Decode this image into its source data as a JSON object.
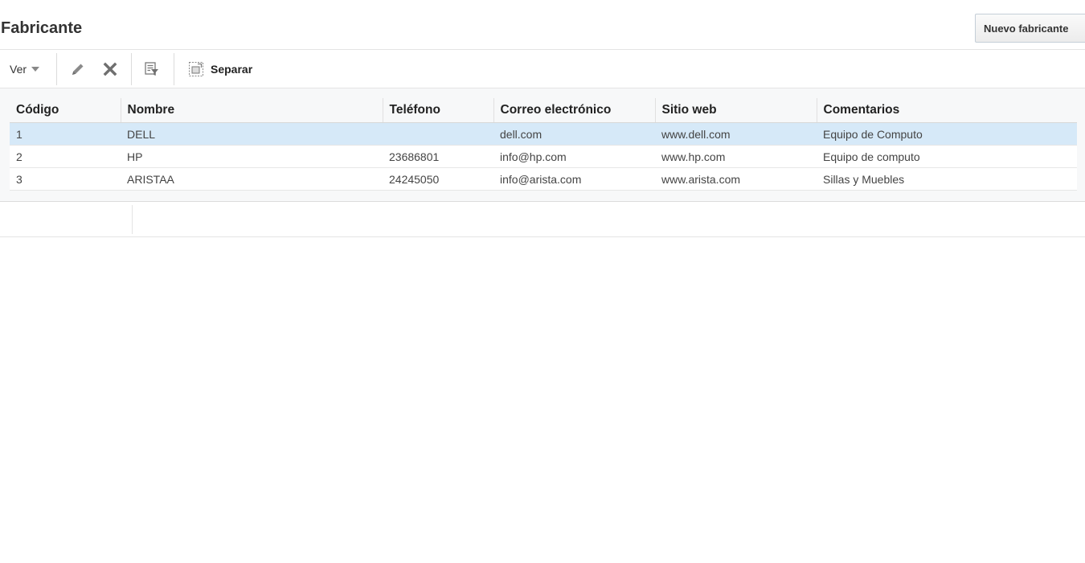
{
  "header": {
    "title": "Fabricante",
    "new_button_label": "Nuevo fabricante"
  },
  "toolbar": {
    "view_label": "Ver",
    "detach_label": "Separar",
    "icons": [
      "pencil-icon",
      "delete-x-icon",
      "filter-icon",
      "detach-icon"
    ]
  },
  "table": {
    "columns": [
      "Código",
      "Nombre",
      "Teléfono",
      "Correo electrónico",
      "Sitio web",
      "Comentarios"
    ],
    "rows": [
      [
        "1",
        "DELL",
        "",
        "dell.com",
        "www.dell.com",
        "Equipo de Computo"
      ],
      [
        "2",
        "HP",
        "23686801",
        "info@hp.com",
        "www.hp.com",
        "Equipo de computo"
      ],
      [
        "3",
        "ARISTAA",
        "24245050",
        "info@arista.com",
        "www.arista.com",
        "Sillas y Muebles"
      ]
    ],
    "selected_row_index": 0
  },
  "colors": {
    "selected_row": "#d6e9f8",
    "panel_background": "#f7f8f9"
  }
}
